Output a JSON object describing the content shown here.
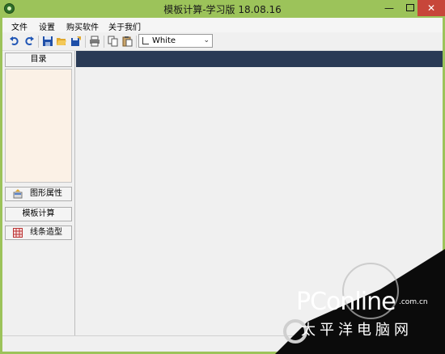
{
  "window": {
    "title": "模板计算-学习版 18.08.16"
  },
  "menu": {
    "items": [
      "文件",
      "设置",
      "购买软件",
      "关于我们"
    ]
  },
  "toolbar": {
    "color_select": {
      "value": "White"
    }
  },
  "left_panel": {
    "toc_button": "目录",
    "shape_props_button": "图形属性",
    "template_calc_button": "模板计算",
    "line_style_button": "线条造型"
  },
  "watermark": {
    "logo": "PConline",
    "domain": ".com.cn",
    "subtitle": "太平洋电脑网"
  },
  "colors": {
    "window_frame": "#9cc35a",
    "header_bar": "#2a3a55",
    "toc_background": "#fbf1e6",
    "close_button": "#c7463a"
  }
}
